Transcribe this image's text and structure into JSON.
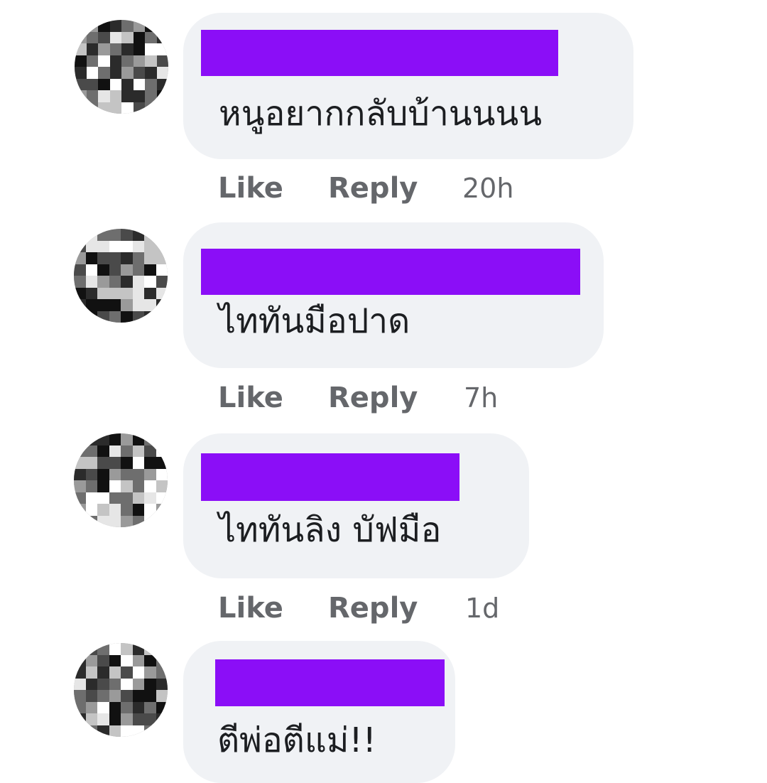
{
  "colors": {
    "bubble": "#f0f2f5",
    "redaction": "#8b0ef7",
    "meta_text": "#65676b",
    "comment_text": "#1c1e21"
  },
  "comments": [
    {
      "text": "หนูอยากกลับบ้านนนน",
      "like_label": "Like",
      "reply_label": "Reply",
      "time": "20h"
    },
    {
      "text": "ไททันมือปาด",
      "like_label": "Like",
      "reply_label": "Reply",
      "time": "7h"
    },
    {
      "text": "ไททันลิง บัฟมือ",
      "like_label": "Like",
      "reply_label": "Reply",
      "time": "1d"
    },
    {
      "text": "ตีพ่อตีแม่!!"
    }
  ]
}
